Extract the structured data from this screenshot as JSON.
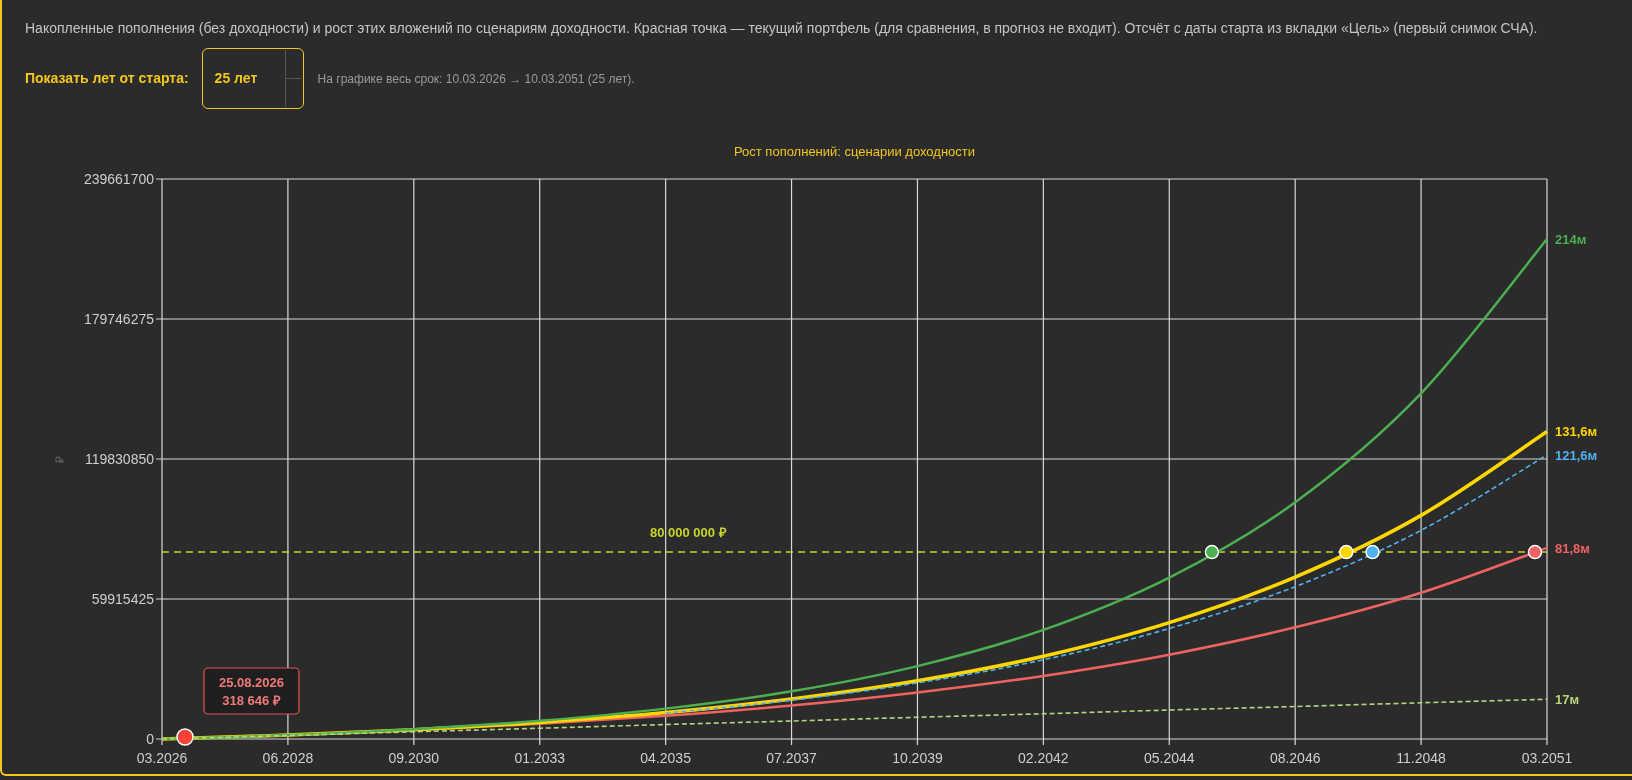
{
  "description": "Накопленные пополнения (без доходности) и рост этих вложений по сценариям доходности. Красная точка — текущий портфель (для сравнения, в прогноз не входит). Отсчёт с даты старта из вкладки «Цель» (первый снимок СЧА).",
  "years_control": {
    "label": "Показать лет от старта:",
    "value": "25 лет",
    "hint": "На графике весь срок: 10.03.2026 → 10.03.2051 (25 лет)."
  },
  "chart": {
    "line_styles": [
      {
        "kind": "normal",
        "target_point": true
      },
      {
        "kind": "bold",
        "target_point": true
      },
      {
        "kind": "thin",
        "target_point": true
      },
      {
        "kind": "normal",
        "target_point": true
      },
      {
        "kind": "thin",
        "target_point": false
      }
    ],
    "current_portfolio": {
      "color": "#f44336",
      "date": "25.08.2026",
      "value": "318 646 ₽"
    },
    "chart_data": {
      "type": "line",
      "title": "Рост пополнений: сценарии доходности",
      "ylabel": "₽",
      "grid": true,
      "categories": [
        "03.2026",
        "06.2028",
        "09.2030",
        "01.2033",
        "04.2035",
        "07.2037",
        "10.2039",
        "02.2042",
        "05.2044",
        "08.2046",
        "11.2048",
        "03.2051"
      ],
      "series": [
        {
          "color": "#4caf50",
          "line_style": "solid",
          "values": [
            0,
            1700000,
            4200000,
            7800000,
            13000000,
            20400000,
            31200000,
            46700000,
            69100000,
            101300000,
            147900000,
            214000000
          ]
        },
        {
          "color": "#ffd700",
          "line_style": "solid",
          "values": [
            0,
            1700000,
            4000000,
            7100000,
            11300000,
            17100000,
            24900000,
            35400000,
            49800000,
            69300000,
            95700000,
            131600000
          ]
        },
        {
          "color": "#4fb3f0",
          "line_style": "dashed",
          "values": [
            null,
            null,
            null,
            null,
            11100000,
            16600000,
            24000000,
            33900000,
            47300000,
            65200000,
            89300000,
            121600000
          ]
        },
        {
          "color": "#f06262",
          "line_style": "solid",
          "values": [
            0,
            1700000,
            3800000,
            6500000,
            9900000,
            14300000,
            19900000,
            27000000,
            36100000,
            47800000,
            62600000,
            81800000
          ]
        },
        {
          "color": "#b5d67a",
          "line_style": "dashed",
          "values": [
            0,
            1500000,
            3100000,
            4600000,
            6200000,
            7700000,
            9300000,
            10800000,
            12400000,
            13900000,
            15500000,
            17000000
          ]
        }
      ],
      "ylim": [
        0,
        239661700
      ],
      "yticks": [
        0,
        59915425,
        119830850,
        179746275,
        239661700
      ],
      "ref_lines": [
        {
          "axis": "y",
          "value": 80000000,
          "label": "80 000 000 ₽",
          "color": "#c8d42a"
        }
      ],
      "annotations": [
        "214м",
        "131,6м",
        "121,6м",
        "81,8м",
        "17м"
      ]
    }
  }
}
